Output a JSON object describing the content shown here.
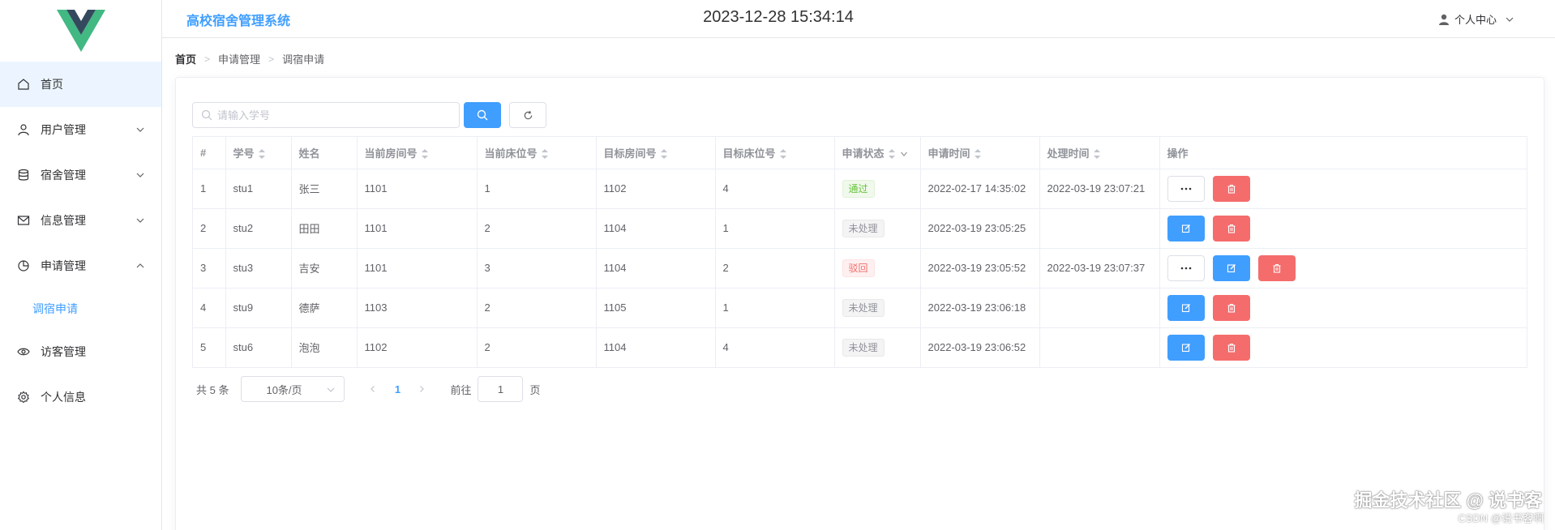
{
  "header": {
    "app_title": "高校宿舍管理系统",
    "datetime": "2023-12-28 15:34:14",
    "user_menu_label": "个人中心"
  },
  "sidebar": {
    "items": [
      {
        "label": "首页",
        "icon": "home-icon",
        "active": true
      },
      {
        "label": "用户管理",
        "icon": "user-icon",
        "expandable": true
      },
      {
        "label": "宿舍管理",
        "icon": "database-icon",
        "expandable": true
      },
      {
        "label": "信息管理",
        "icon": "mail-icon",
        "expandable": true
      },
      {
        "label": "申请管理",
        "icon": "pie-chart-icon",
        "expandable": true,
        "expanded": true
      },
      {
        "label": "访客管理",
        "icon": "eye-icon"
      },
      {
        "label": "个人信息",
        "icon": "gear-icon"
      }
    ],
    "sub_item": "调宿申请"
  },
  "breadcrumb": [
    "首页",
    "申请管理",
    "调宿申请"
  ],
  "search": {
    "placeholder": "请输入学号",
    "value": ""
  },
  "table": {
    "columns": [
      "#",
      "学号",
      "姓名",
      "当前房间号",
      "当前床位号",
      "目标房间号",
      "目标床位号",
      "申请状态",
      "申请时间",
      "处理时间",
      "操作"
    ],
    "rows": [
      {
        "idx": "1",
        "sid": "stu1",
        "name": "张三",
        "cur_room": "1101",
        "cur_bed": "1",
        "tgt_room": "1102",
        "tgt_bed": "4",
        "status": "通过",
        "status_type": "success",
        "apply_time": "2022-02-17 14:35:02",
        "handle_time": "2022-03-19 23:07:21"
      },
      {
        "idx": "2",
        "sid": "stu2",
        "name": "田田",
        "cur_room": "1101",
        "cur_bed": "2",
        "tgt_room": "1104",
        "tgt_bed": "1",
        "status": "未处理",
        "status_type": "info",
        "apply_time": "2022-03-19 23:05:25",
        "handle_time": ""
      },
      {
        "idx": "3",
        "sid": "stu3",
        "name": "吉安",
        "cur_room": "1101",
        "cur_bed": "3",
        "tgt_room": "1104",
        "tgt_bed": "2",
        "status": "驳回",
        "status_type": "danger",
        "apply_time": "2022-03-19 23:05:52",
        "handle_time": "2022-03-19 23:07:37"
      },
      {
        "idx": "4",
        "sid": "stu9",
        "name": "德萨",
        "cur_room": "1103",
        "cur_bed": "2",
        "tgt_room": "1105",
        "tgt_bed": "1",
        "status": "未处理",
        "status_type": "info",
        "apply_time": "2022-03-19 23:06:18",
        "handle_time": ""
      },
      {
        "idx": "5",
        "sid": "stu6",
        "name": "泡泡",
        "cur_room": "1102",
        "cur_bed": "2",
        "tgt_room": "1104",
        "tgt_bed": "4",
        "status": "未处理",
        "status_type": "info",
        "apply_time": "2022-03-19 23:06:52",
        "handle_time": ""
      }
    ]
  },
  "pagination": {
    "total_label": "共 5 条",
    "page_size_label": "10条/页",
    "current_page": "1",
    "goto_label": "前往",
    "goto_value": "1",
    "page_unit": "页"
  },
  "watermark": {
    "line1": "掘金技术社区 @ 说书客",
    "line2": "CSDN @说书客啊"
  },
  "colors": {
    "primary": "#409eff",
    "danger": "#f56c6c",
    "success": "#67c23a",
    "info": "#909399"
  }
}
